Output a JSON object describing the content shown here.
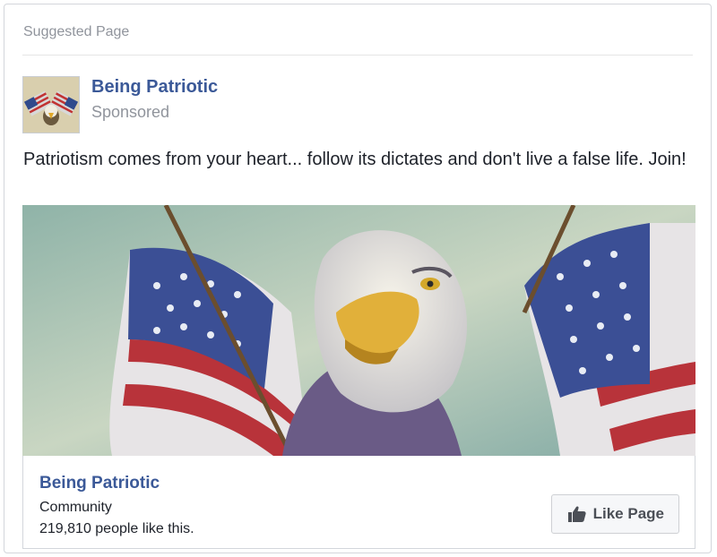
{
  "card": {
    "header": "Suggested Page"
  },
  "post": {
    "page_name": "Being Patriotic",
    "label": "Sponsored",
    "text": "Patriotism comes from your heart... follow its dictates and don't live a false life. Join!",
    "avatar_icon": "eagle-flags-icon",
    "image_icon": "eagle-with-flags-illustration"
  },
  "attachment": {
    "page_name": "Being Patriotic",
    "category": "Community",
    "likes": "219,810 people like this.",
    "button_label": "Like Page",
    "button_icon": "thumbs-up-icon"
  },
  "colors": {
    "link_blue": "#3b5998",
    "muted_gray": "#90949c",
    "border": "#d3d6db"
  }
}
